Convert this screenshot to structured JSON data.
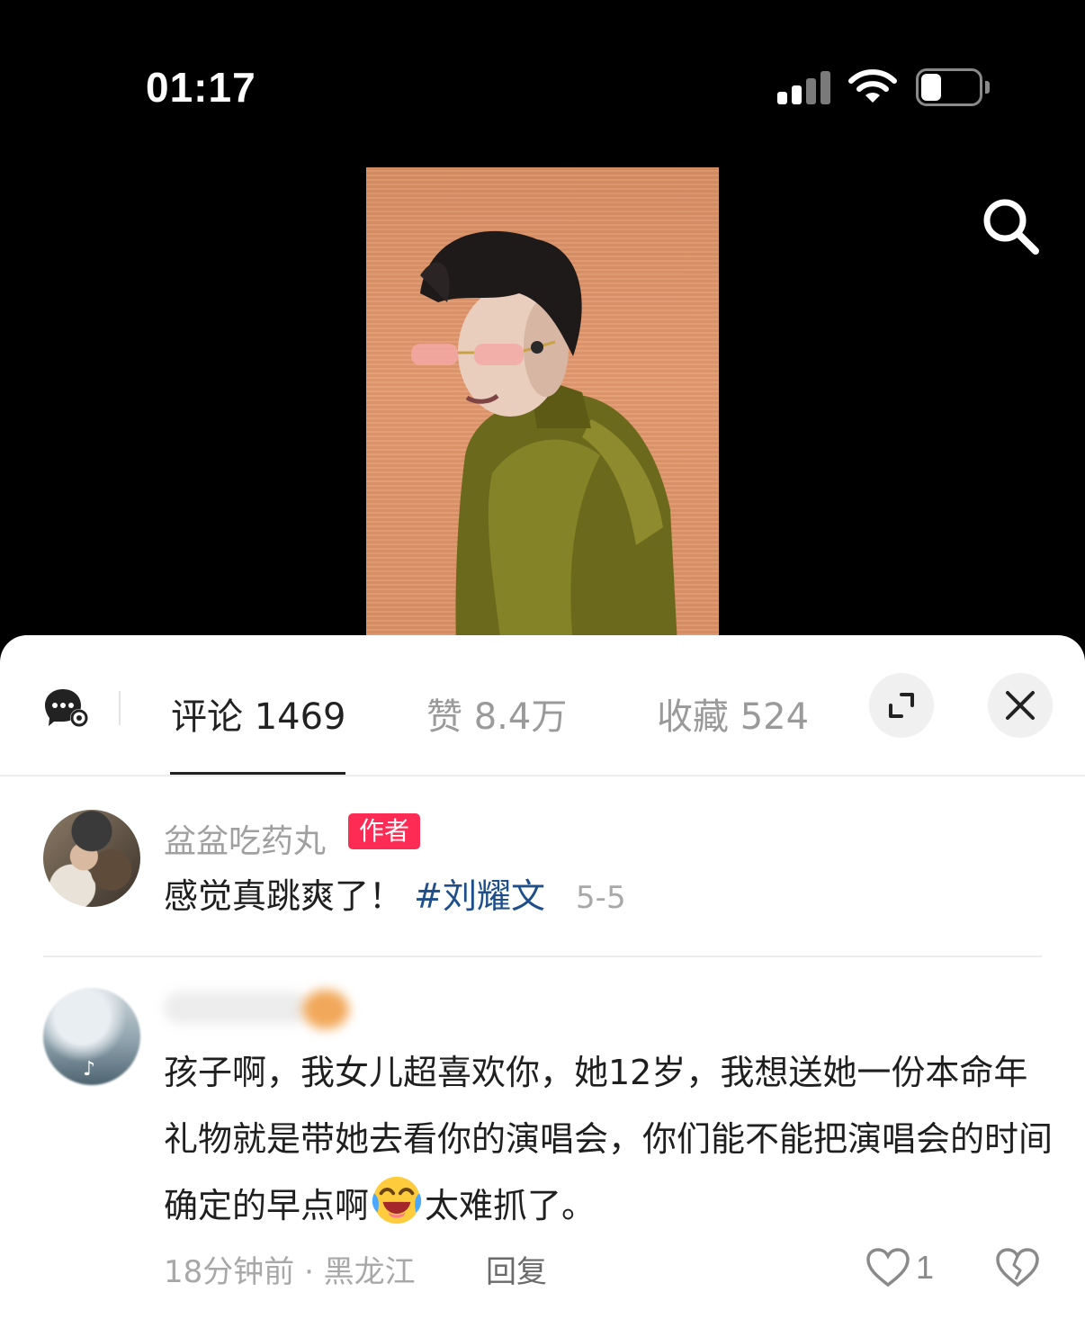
{
  "status_bar": {
    "time": "01:17",
    "signal_icon": "cellular-signal-icon",
    "wifi_icon": "wifi-icon",
    "battery_icon": "battery-icon"
  },
  "video": {
    "search_icon": "search-icon"
  },
  "sheet": {
    "tabs": [
      {
        "label": "评论 1469",
        "active": true
      },
      {
        "label": "赞 8.4万",
        "active": false
      },
      {
        "label": "收藏 524",
        "active": false
      }
    ],
    "icons": {
      "settings": "chat-settings-icon",
      "expand": "expand-icon",
      "close": "close-icon"
    }
  },
  "comments": [
    {
      "username": "盆盆吃药丸",
      "badge": "作者",
      "text": "感觉真跳爽了！",
      "hashtag": "#刘耀文",
      "date": "5-5"
    },
    {
      "username": "",
      "text_before_emoji": "孩子啊，我女儿超喜欢你，她12岁，我想送她一份本命年礼物就是带她去看你的演唱会，你们能不能把演唱会的时间确定的早点啊",
      "emoji": "laughing-tears-emoji",
      "text_after_emoji": "太难抓了。",
      "meta": "18分钟前 · 黑龙江",
      "reply_label": "回复",
      "like_count": "1"
    }
  ],
  "colors": {
    "accent_badge": "#fe2c55",
    "hashtag": "#1f4f8a",
    "muted_text": "#a8a8a8"
  }
}
